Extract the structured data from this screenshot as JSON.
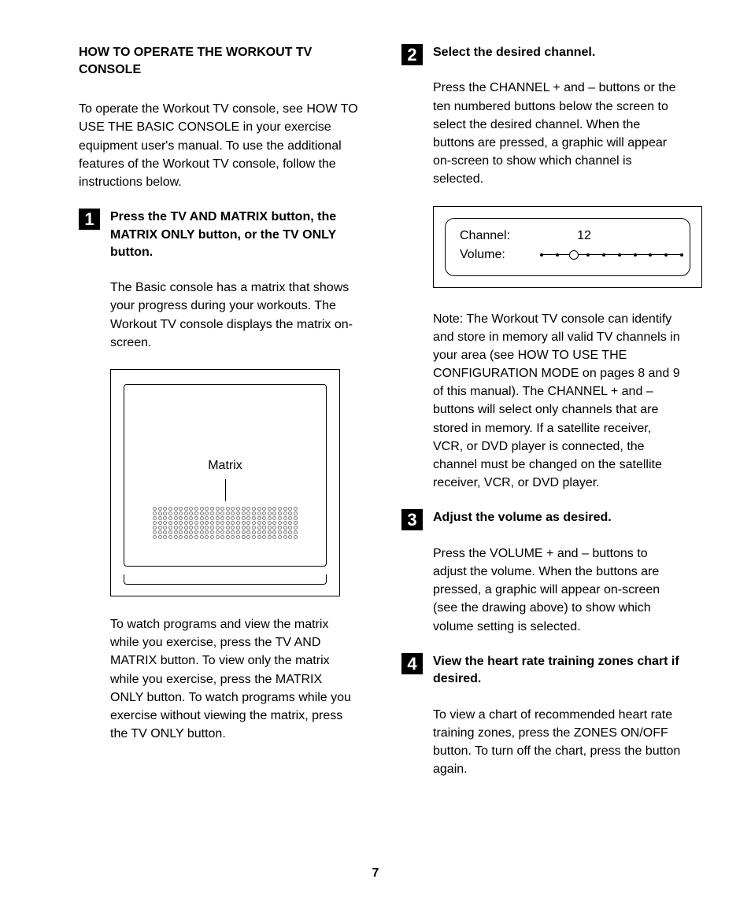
{
  "title": "HOW TO OPERATE THE WORKOUT TV CONSOLE",
  "intro": "To operate the Workout TV console, see HOW TO USE THE BASIC CONSOLE in your exercise equipment user's manual. To use the additional features of the Workout TV console, follow the instructions below.",
  "steps": {
    "s1": {
      "num": "1",
      "title": "Press the TV AND MATRIX button, the MATRIX ONLY button, or the TV ONLY button.",
      "body_a": "The Basic console has a matrix that shows your progress during your workouts. The Workout TV console displays the matrix on-screen.",
      "figure_label": "Matrix",
      "body_b": "To watch programs and view the matrix while you exercise, press the TV AND MATRIX button. To view only the matrix while you exercise, press the MATRIX ONLY button. To watch programs while you exercise without viewing the matrix, press the TV ONLY button."
    },
    "s2": {
      "num": "2",
      "title": "Select the desired channel.",
      "body_a": "Press the CHANNEL + and – buttons or the ten numbered buttons below the screen to select the desired channel. When the buttons are pressed, a graphic will appear on-screen to show which channel is selected.",
      "channel_label": "Channel:",
      "channel_value": "12",
      "volume_label": "Volume:",
      "body_b": "Note: The Workout TV console can identify and store in memory all valid TV channels in your area (see HOW TO USE THE CONFIGURATION MODE on pages 8 and 9 of this manual). The CHANNEL + and – buttons will select only channels that are stored in memory. If a satellite receiver, VCR, or DVD player is connected, the channel must be changed on the satellite receiver, VCR, or DVD player."
    },
    "s3": {
      "num": "3",
      "title": "Adjust the volume as desired.",
      "body": "Press the VOLUME + and – buttons to adjust the volume. When the buttons are pressed, a graphic will appear on-screen (see the drawing above) to show which volume setting is selected."
    },
    "s4": {
      "num": "4",
      "title": "View the heart rate training zones chart if desired.",
      "body": "To view a chart of recommended heart rate training zones, press the ZONES ON/OFF button. To turn off the chart, press the button again."
    }
  },
  "page_number": "7"
}
